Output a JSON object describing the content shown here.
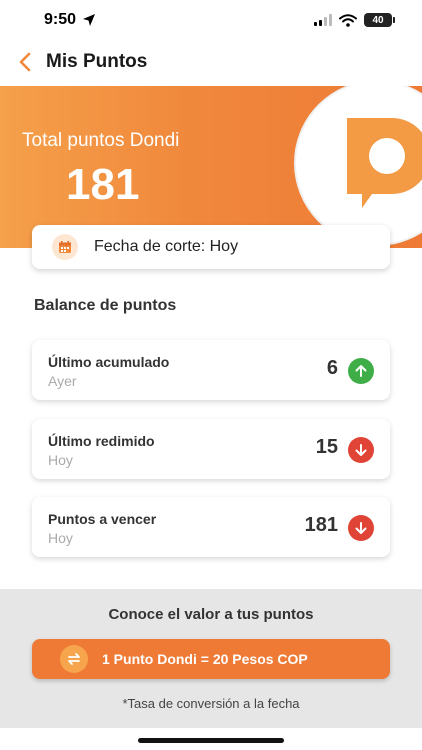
{
  "status_bar": {
    "time": "9:50",
    "battery": "40"
  },
  "header": {
    "title": "Mis Puntos"
  },
  "banner": {
    "label": "Total puntos Dondi",
    "value": "181"
  },
  "cutoff": {
    "text": "Fecha de corte: Hoy"
  },
  "balance": {
    "title": "Balance de puntos",
    "items": [
      {
        "title": "Último acumulado",
        "subtitle": "Ayer",
        "value": "6",
        "direction": "up"
      },
      {
        "title": "Último redimido",
        "subtitle": "Hoy",
        "value": "15",
        "direction": "down"
      },
      {
        "title": "Puntos a vencer",
        "subtitle": "Hoy",
        "value": "181",
        "direction": "down"
      }
    ]
  },
  "conversion": {
    "title": "Conoce el valor a tus puntos",
    "button_label": "1 Punto Dondi = 20 Pesos COP",
    "note": "*Tasa de conversión a la fecha"
  },
  "colors": {
    "brand_orange": "#ee7a36",
    "up_green": "#3fae49",
    "down_red": "#e04437"
  },
  "icons": {
    "back": "chevron-left-icon",
    "calendar": "calendar-icon",
    "up": "arrow-up-icon",
    "down": "arrow-down-icon",
    "swap": "swap-icon"
  }
}
